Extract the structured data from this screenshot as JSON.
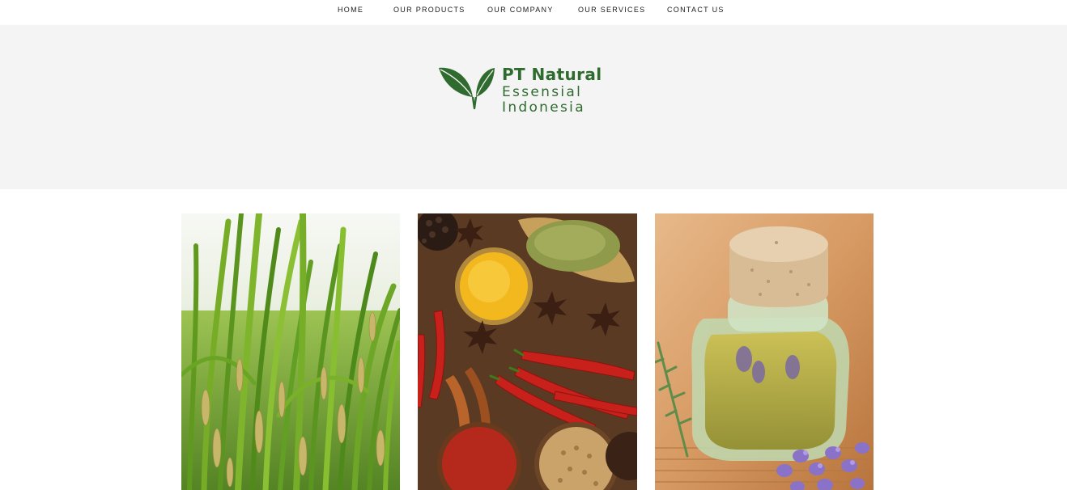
{
  "nav": {
    "items": [
      {
        "label": "HOME"
      },
      {
        "label": "OUR PRODUCTS"
      },
      {
        "label": "OUR COMPANY"
      },
      {
        "label": "OUR SERVICES"
      },
      {
        "label": "CONTACT US"
      }
    ]
  },
  "logo": {
    "line1": "PT Natural",
    "line2": "Essensial",
    "line3": "Indonesia",
    "icon": "leaf-icon",
    "brand_color": "#2f6b2e"
  },
  "colors": {
    "hero_background": "#f4f4f4",
    "page_background": "#ffffff"
  },
  "tiles": [
    {
      "image": "rice-plants"
    },
    {
      "image": "assorted-spices"
    },
    {
      "image": "essential-oil-bottle"
    }
  ]
}
